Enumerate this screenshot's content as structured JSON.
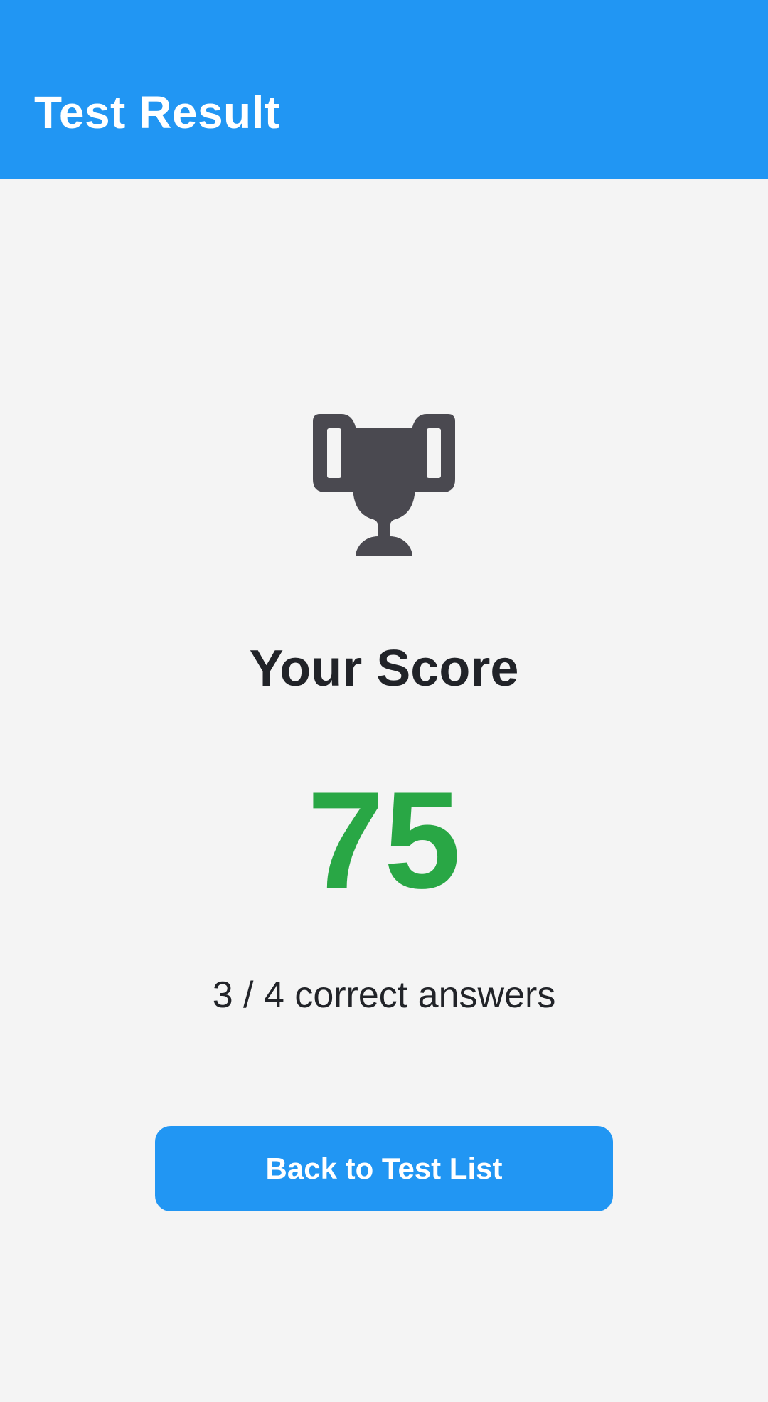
{
  "app_bar": {
    "title": "Test Result",
    "color": "#2196f3"
  },
  "result": {
    "icon": "trophy-icon",
    "heading": "Your Score",
    "score": "75",
    "score_color": "#29a745",
    "detail": "3 / 4 correct answers"
  },
  "actions": {
    "back_label": "Back to Test List"
  }
}
